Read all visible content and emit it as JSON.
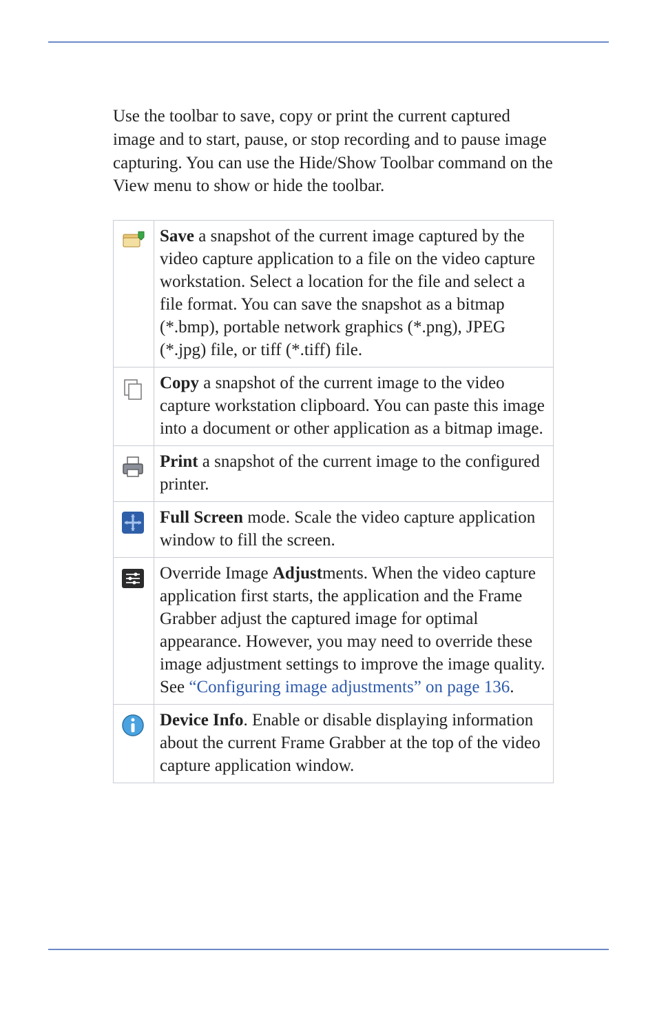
{
  "intro": "Use the toolbar to save, copy or print the current captured image and to start, pause, or stop recording and to pause image capturing. You can use the Hide/Show Toolbar command on the View menu to show or hide the toolbar.",
  "rows": [
    {
      "icon": "save-icon",
      "bold": "Save",
      "rest": " a snapshot of the current image captured by the video capture application to a file on the video capture workstation. Select a location for the file and select a file format. You can save the snapshot as a bitmap (*.bmp), portable network graphics (*.png), JPEG (*.jpg) file, or tiff (*.tiff) file."
    },
    {
      "icon": "copy-icon",
      "bold": "Copy",
      "rest": " a snapshot of the current image to the video capture workstation clipboard. You can paste this image into a document or other application as a bitmap image."
    },
    {
      "icon": "print-icon",
      "bold": "Print",
      "rest": " a snapshot of the current image to the configured printer."
    },
    {
      "icon": "fullscreen-icon",
      "bold": "Full Screen",
      "rest": " mode. Scale the video capture application window to fill the screen."
    },
    {
      "icon": "adjust-icon",
      "pre": "Override Image ",
      "bold": "Adjust",
      "rest": "ments. When the video capture application first starts, the application and the Frame Grabber adjust the captured image for optimal appearance. However, you may need to override these image adjustment settings to improve the image quality. See ",
      "link": "“Configuring image adjustments” on page 136",
      "post": "."
    },
    {
      "icon": "info-icon",
      "bold": "Device Info",
      "rest": ". Enable or disable displaying information about the current Frame Grabber at the top of the video capture application window."
    }
  ]
}
